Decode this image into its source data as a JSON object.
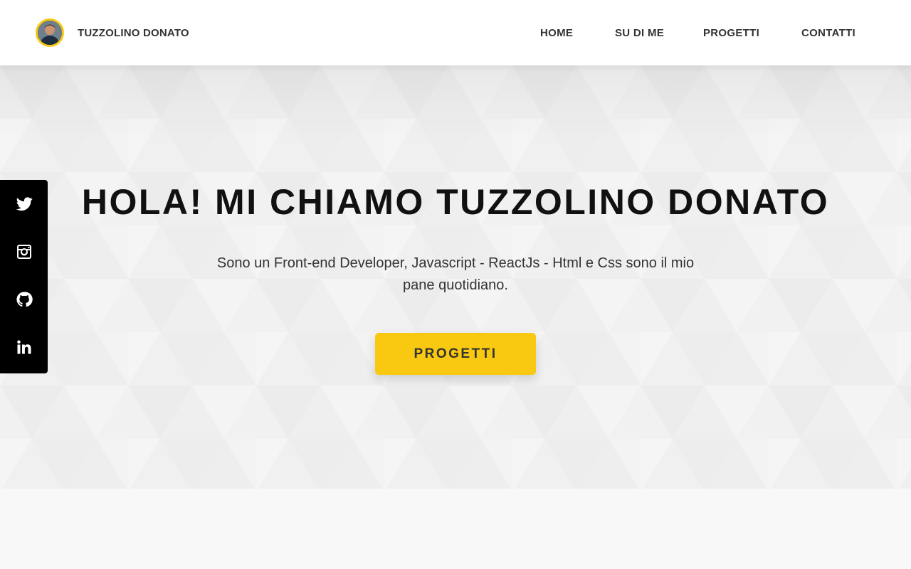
{
  "header": {
    "brand_name": "TUZZOLINO DONATO",
    "nav": {
      "home": "HOME",
      "about": "SU DI ME",
      "projects": "PROGETTI",
      "contacts": "CONTATTI"
    }
  },
  "hero": {
    "title": "HOLA! MI CHIAMO TUZZOLINO DONATO",
    "subtitle": "Sono un Front-end Developer, Javascript - ReactJs - Html e Css sono il mio pane quotidiano.",
    "cta_label": "PROGETTI"
  },
  "social": {
    "items": [
      {
        "icon": "twitter-icon"
      },
      {
        "icon": "instagram-icon"
      },
      {
        "icon": "github-icon"
      },
      {
        "icon": "linkedin-icon"
      }
    ]
  },
  "colors": {
    "accent": "#f8c910",
    "text_dark": "#111111",
    "text": "#333333",
    "header_bg": "#ffffff",
    "sidebar_bg": "#000000",
    "hero_bg": "#f1f1f1"
  }
}
